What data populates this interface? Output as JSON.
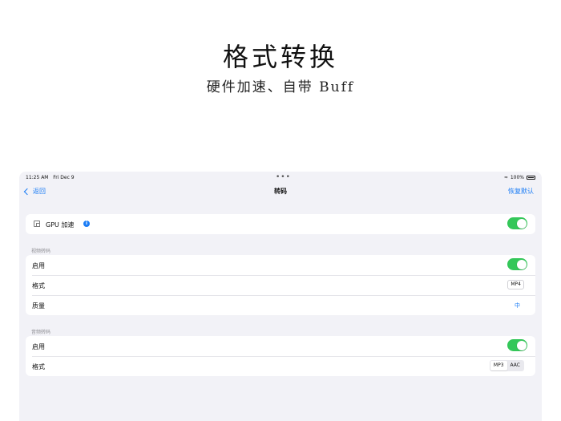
{
  "hero": {
    "title": "格式转换",
    "subtitle": "硬件加速、自带 Buff"
  },
  "status_bar": {
    "time": "11:25 AM",
    "date": "Fri Dec 9",
    "battery": "100%",
    "icons": [
      "wifi-icon",
      "battery-icon"
    ]
  },
  "nav": {
    "back_label": "返回",
    "title": "转码",
    "restore_label": "恢复默认"
  },
  "gpu": {
    "label": "GPU 加速",
    "info_glyph": "i",
    "enabled": true
  },
  "video": {
    "section_label": "视频转码",
    "enable_label": "启用",
    "enabled": true,
    "format_label": "格式",
    "format_value": "MP4",
    "quality_label": "质量",
    "quality_value": "中"
  },
  "audio": {
    "section_label": "音频转码",
    "enable_label": "启用",
    "enabled": true,
    "format_label": "格式",
    "format_options": [
      "MP3",
      "AAC"
    ],
    "format_selected": "MP3"
  },
  "colors": {
    "accent": "#1a7cf5",
    "toggle_on": "#34c759",
    "background": "#f2f2f7"
  }
}
